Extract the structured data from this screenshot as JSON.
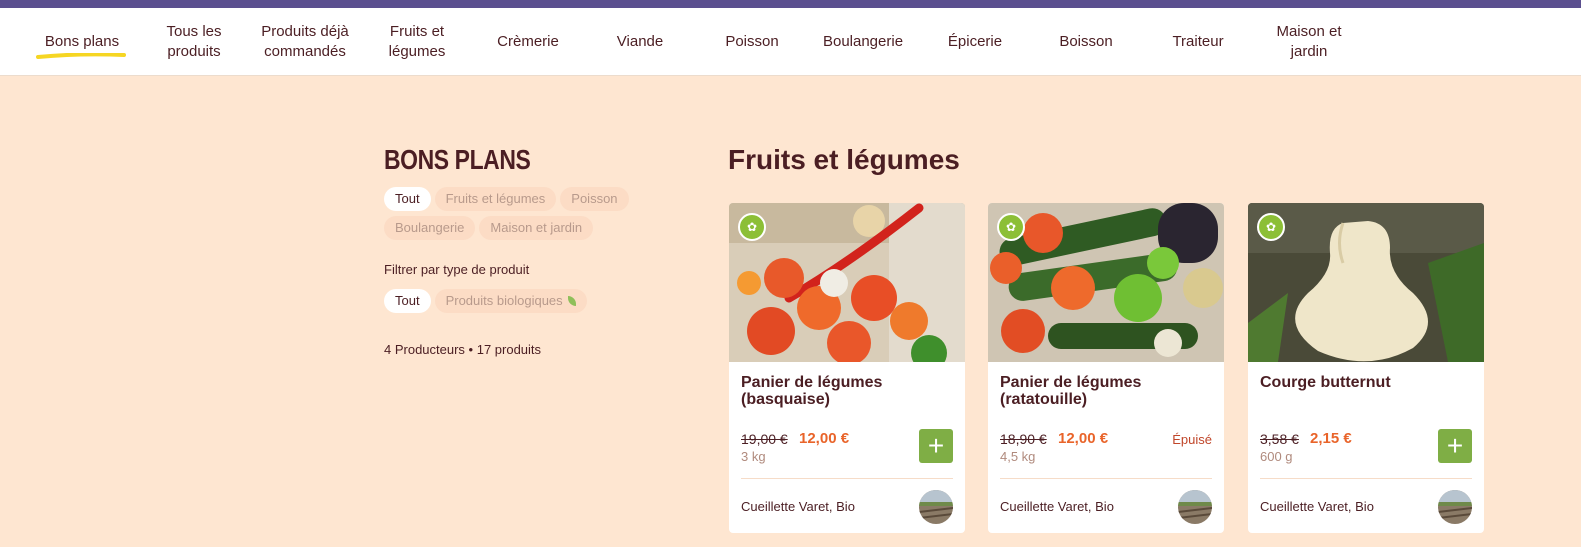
{
  "colors": {
    "brand_bar": "#5b4f8f",
    "page_bg": "#fee6d1",
    "text": "#4b1e23",
    "price": "#e9642a",
    "add": "#7fae45",
    "highlight": "#f6d623"
  },
  "nav": {
    "items": [
      {
        "label": "Bons plans",
        "active": true
      },
      {
        "label": "Tous les produits"
      },
      {
        "label": "Produits déjà commandés"
      },
      {
        "label": "Fruits et légumes"
      },
      {
        "label": "Crèmerie"
      },
      {
        "label": "Viande"
      },
      {
        "label": "Poisson"
      },
      {
        "label": "Boulangerie"
      },
      {
        "label": "Épicerie"
      },
      {
        "label": "Boisson"
      },
      {
        "label": "Traiteur"
      },
      {
        "label": "Maison et jardin"
      }
    ]
  },
  "sidebar": {
    "title": "BONS PLANS",
    "categories": [
      {
        "label": "Tout",
        "active": true
      },
      {
        "label": "Fruits et légumes"
      },
      {
        "label": "Poisson"
      },
      {
        "label": "Boulangerie"
      },
      {
        "label": "Maison et jardin"
      }
    ],
    "filter_label": "Filtrer par type de produit",
    "type_filters": [
      {
        "label": "Tout",
        "active": true
      },
      {
        "label": "Produits biologiques",
        "icon": "leaf-icon"
      }
    ],
    "counts": "4 Producteurs • 17 produits"
  },
  "main": {
    "section_title": "Fruits et légumes",
    "products": [
      {
        "name": "Panier de légumes (basquaise)",
        "old_price": "19,00 €",
        "price": "12,00 €",
        "weight": "3 kg",
        "producer": "Cueillette Varet, Bio",
        "sold_out": false,
        "bio": true
      },
      {
        "name": "Panier de légumes (ratatouille)",
        "old_price": "18,90 €",
        "price": "12,00 €",
        "weight": "4,5 kg",
        "producer": "Cueillette Varet, Bio",
        "sold_out": true,
        "sold_out_label": "Épuisé",
        "bio": true
      },
      {
        "name": "Courge butternut",
        "old_price": "3,58 €",
        "price": "2,15 €",
        "weight": "600 g",
        "producer": "Cueillette Varet, Bio",
        "sold_out": false,
        "bio": true
      }
    ]
  }
}
